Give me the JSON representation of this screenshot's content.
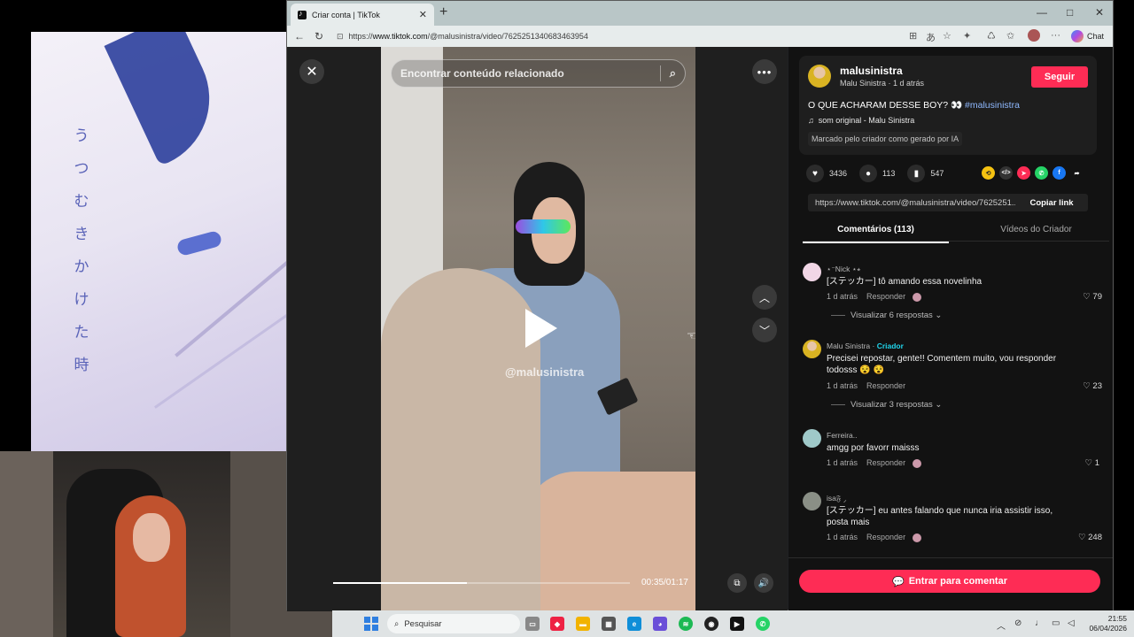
{
  "anime_overlay": {
    "vertical_text": [
      "う",
      "つ",
      "む",
      "き",
      "か",
      "け",
      "た",
      "時"
    ]
  },
  "browser": {
    "tab_title": "Criar conta | TikTok",
    "tab_close": "✕",
    "new_tab": "+",
    "url_prefix": "https://",
    "url_host": "www.tiktok.com",
    "url_path": "/@malusinistra/video/7625251340683463954",
    "chat_label": "Chat",
    "window_controls": {
      "minimize": "—",
      "maximize": "□",
      "close": "✕"
    }
  },
  "video": {
    "search_placeholder": "Encontrar conteúdo relacionado",
    "watermark": "@malusinistra",
    "timecode": "00:35/01:17",
    "progress": 0.45
  },
  "post": {
    "author": "malusinistra",
    "author_meta": "Malu Sinistra · 1 d atrás",
    "follow_label": "Seguir",
    "caption": "O QUE ACHARAM DESSE BOY? 👀",
    "hashtag": "#malusinistra",
    "sound": "som original - Malu Sinistra",
    "ai_label": "Marcado pelo criador como gerado por IA",
    "likes": "3436",
    "comments": "113",
    "saves": "547",
    "link": "https://www.tiktok.com/@malusinistra/video/7625251...",
    "copy_link": "Copiar link"
  },
  "tabs": {
    "comments": "Comentários (113)",
    "creator_videos": "Vídeos do Criador"
  },
  "comments": [
    {
      "name": "⋆⁻Nick ⋆⭒",
      "text": "[ステッカー] tô amando essa novelinha",
      "time": "1 d atrás",
      "reply": "Responder",
      "likes": "79",
      "view_replies": "Visualizar 6 respostas ⌄"
    },
    {
      "name": "Malu Sinistra",
      "creator_tag": "Criador",
      "text": "Precisei repostar, gente!! Comentem muito, vou responder todosss 😵 😵",
      "time": "1 d atrás",
      "reply": "Responder",
      "likes": "23",
      "view_replies": "Visualizar 3 respostas ⌄"
    },
    {
      "name": "Ferreira..",
      "text": "amgg por favorr maisss",
      "time": "1 d atrás",
      "reply": "Responder",
      "likes": "1"
    },
    {
      "name": "isa𝔉 ⸝",
      "text": "[ステッカー] eu antes falando que nunca iria assistir isso, posta mais",
      "time": "1 d atrás",
      "reply": "Responder",
      "likes": "248"
    }
  ],
  "enter_comment": "Entrar para comentar",
  "taskbar": {
    "search": "Pesquisar",
    "time": "21:55",
    "date": "06/04/2026"
  },
  "colors": {
    "accent": "#fe2c55",
    "creator": "#20d5ec",
    "hashtag": "#8fb9ff"
  }
}
